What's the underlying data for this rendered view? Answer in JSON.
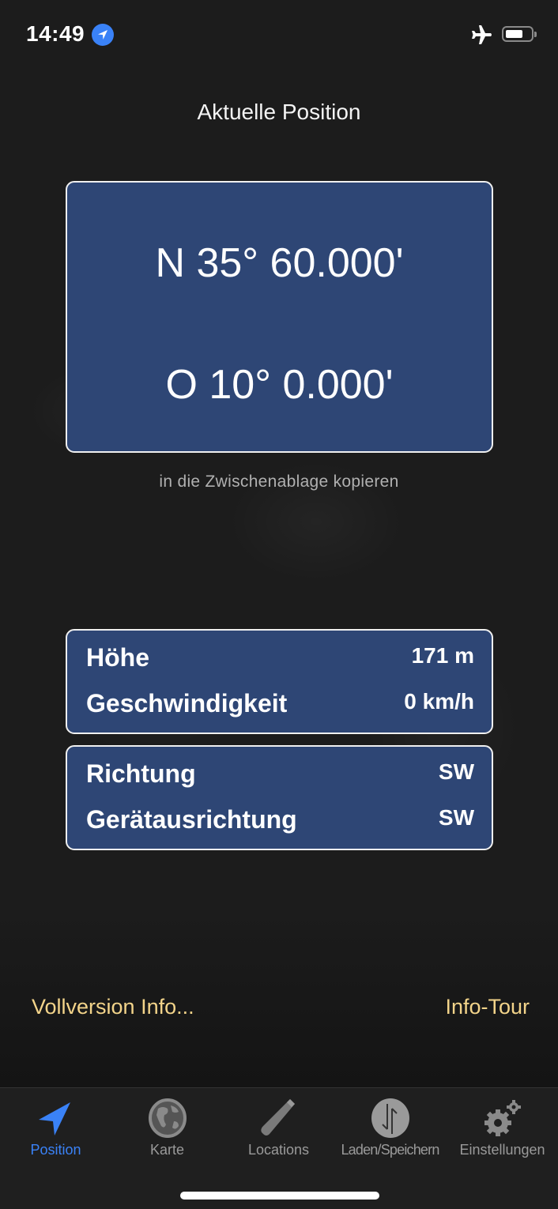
{
  "status_bar": {
    "time": "14:49",
    "icons": [
      "location-arrow-icon",
      "airplane-icon",
      "battery-icon"
    ]
  },
  "header": {
    "title": "Aktuelle Position"
  },
  "coordinates": {
    "latitude": "N 35° 60.000'",
    "longitude": "O 10° 0.000'",
    "copy_label": "in die Zwischenablage kopieren"
  },
  "info_box_1": {
    "rows": [
      {
        "label": "Höhe",
        "value": "171 m"
      },
      {
        "label": "Geschwindigkeit",
        "value": "0 km/h"
      }
    ]
  },
  "info_box_2": {
    "rows": [
      {
        "label": "Richtung",
        "value": "SW"
      },
      {
        "label": "Gerätausrichtung",
        "value": "SW"
      }
    ]
  },
  "links": {
    "full_version": "Vollversion Info...",
    "info_tour": "Info-Tour"
  },
  "tabbar": {
    "tabs": [
      {
        "label": "Position",
        "icon": "location-arrow-icon",
        "active": true
      },
      {
        "label": "Karte",
        "icon": "globe-icon",
        "active": false
      },
      {
        "label": "Locations",
        "icon": "pencil-icon",
        "active": false
      },
      {
        "label": "Laden/Speichern",
        "icon": "up-down-arrows-icon",
        "active": false
      },
      {
        "label": "Einstellungen",
        "icon": "gears-icon",
        "active": false
      }
    ]
  },
  "colors": {
    "accent": "#3a82f7",
    "box_background": "#2e4675",
    "link": "#f3d48a",
    "background": "#1c1c1c"
  }
}
